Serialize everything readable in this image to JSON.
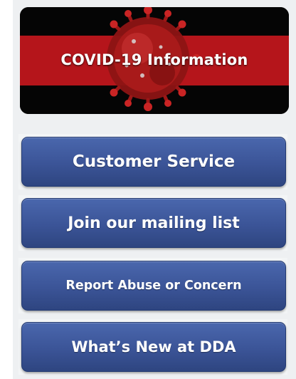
{
  "banner": {
    "text": "COVID-19 Information",
    "stripe_color": "#b5151b",
    "background_color": "#050505",
    "icon": "coronavirus-icon"
  },
  "buttons": [
    {
      "label": "Customer Service"
    },
    {
      "label": "Join our mailing list"
    },
    {
      "label": "Report Abuse or Concern"
    },
    {
      "label": "What’s New at DDA"
    }
  ],
  "colors": {
    "button_blue": "#3b5497",
    "panel_bg": "#eef0f2"
  }
}
